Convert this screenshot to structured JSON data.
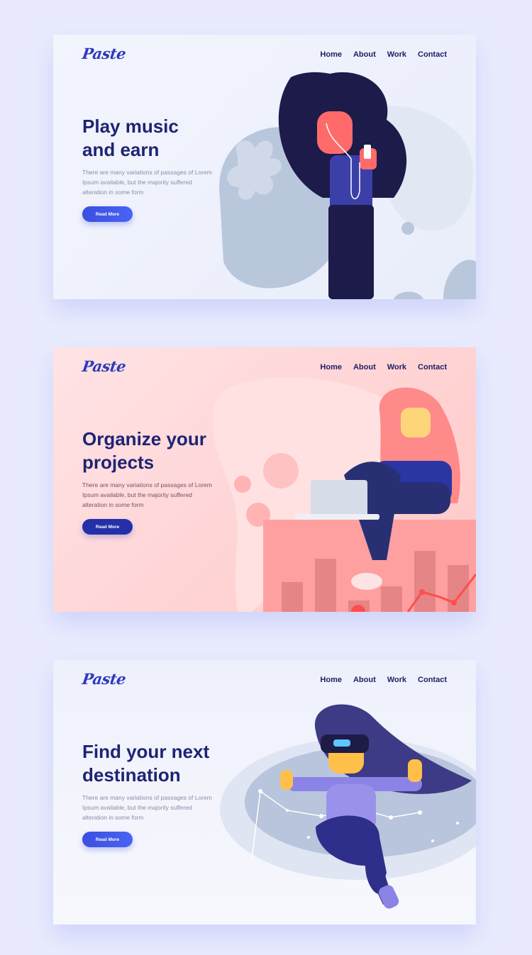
{
  "cards": [
    {
      "logo": "Paste",
      "nav": [
        "Home",
        "About",
        "Work",
        "Contact"
      ],
      "title_line1": "Play music",
      "title_line2": "and earn",
      "description": "There are many variations of passages of Lorem Ipsum available, but the majority suffered alteration in some form",
      "button": "Read More"
    },
    {
      "logo": "Paste",
      "nav": [
        "Home",
        "About",
        "Work",
        "Contact"
      ],
      "title_line1": "Organize your",
      "title_line2": "projects",
      "description": "There are many variations of passages of Lorem Ipsum available, but the majority suffered alteration in some form",
      "button": "Read More"
    },
    {
      "logo": "Paste",
      "nav": [
        "Home",
        "About",
        "Work",
        "Contact"
      ],
      "title_line1": "Find your next",
      "title_line2": "destination",
      "description": "There are many variations of passages of Lorem Ipsum available, but the majority suffered alteration in some form",
      "button": "Read More"
    }
  ],
  "colors": {
    "page_bg": "#e9ebfd",
    "heading": "#1e2474",
    "accent": "#3b4fe0",
    "card2_bg": "#ffd3d5"
  }
}
